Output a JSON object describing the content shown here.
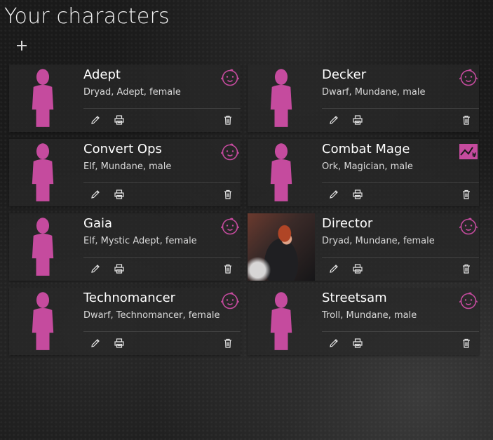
{
  "page": {
    "title": "Your characters"
  },
  "colors": {
    "accent": "#c54b9e",
    "text": "#ffffff",
    "subtext": "#d9d9d9"
  },
  "characters": [
    {
      "name": "Adept",
      "description": "Dryad, Adept, female",
      "badge": "baby-face-icon",
      "avatar": "silhouette"
    },
    {
      "name": "Decker",
      "description": "Dwarf, Mundane, male",
      "badge": "baby-face-icon",
      "avatar": "silhouette"
    },
    {
      "name": "Convert Ops",
      "description": "Elf, Mundane, male",
      "badge": "baby-face-icon",
      "avatar": "silhouette"
    },
    {
      "name": "Combat Mage",
      "description": "Ork, Magician, male",
      "badge": "karma-chart-icon",
      "avatar": "silhouette"
    },
    {
      "name": "Gaia",
      "description": "Elf, Mystic Adept, female",
      "badge": "baby-face-icon",
      "avatar": "silhouette"
    },
    {
      "name": "Director",
      "description": "Dryad, Mundane, female",
      "badge": "baby-face-icon",
      "avatar": "photo"
    },
    {
      "name": "Technomancer",
      "description": "Dwarf, Technomancer, female",
      "badge": "baby-face-icon",
      "avatar": "silhouette"
    },
    {
      "name": "Streetsam",
      "description": "Troll, Mundane, male",
      "badge": "baby-face-icon",
      "avatar": "silhouette"
    }
  ]
}
